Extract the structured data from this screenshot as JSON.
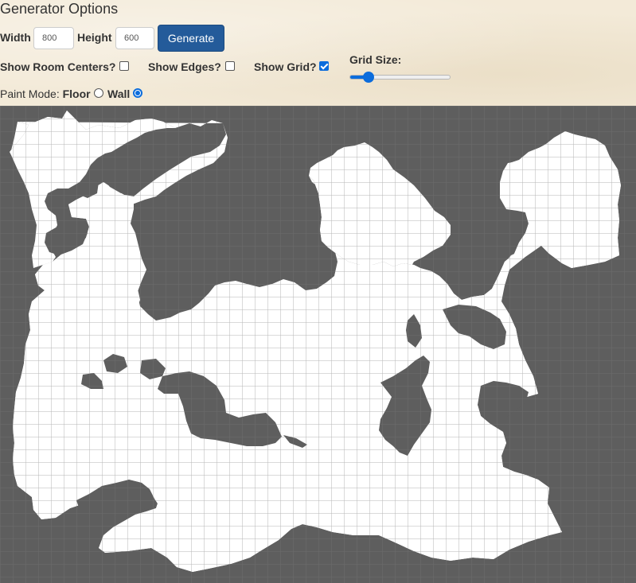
{
  "panel": {
    "title": "Generator Options",
    "width_label": "Width",
    "width_value": "800",
    "height_label": "Height",
    "height_value": "600",
    "generate_label": "Generate",
    "show_room_centers_label": "Show Room Centers?",
    "show_room_centers_checked": false,
    "show_edges_label": "Show Edges?",
    "show_edges_checked": false,
    "show_grid_label": "Show Grid?",
    "show_grid_checked": true,
    "grid_size_label": "Grid Size:",
    "grid_size_level": 0.15,
    "paint_mode_label": "Paint Mode:",
    "floor_label": "Floor",
    "floor_selected": false,
    "wall_label": "Wall",
    "wall_selected": true
  },
  "colors": {
    "wall": "#5e5e5e",
    "floor": "#ffffff",
    "grid": "#7a7a7a",
    "accent": "#0b6cdc",
    "button": "#245b9a",
    "parchment": "#f3ead8"
  },
  "icons": {
    "checkbox": "checkbox",
    "radio": "radio-button"
  }
}
